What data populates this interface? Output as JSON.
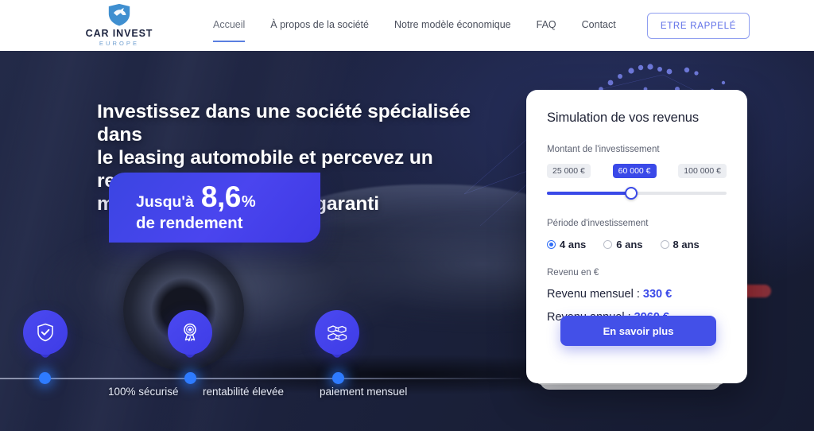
{
  "header": {
    "logo": {
      "name": "CAR INVEST",
      "sub": "EUROPE",
      "mark": "shield-car-icon"
    },
    "nav": [
      {
        "label": "Accueil",
        "active": true
      },
      {
        "label": "À propos de la société",
        "active": false
      },
      {
        "label": "Notre modèle économique",
        "active": false
      },
      {
        "label": "FAQ",
        "active": false
      },
      {
        "label": "Contact",
        "active": false
      }
    ],
    "cta": "ETRE RAPPELÉ"
  },
  "hero": {
    "title_line1": "Investissez dans une société spécialisée dans",
    "title_line2": "le leasing automobile et percevez un revenu",
    "title_line3": "mensuel satisfaisant et garanti",
    "badge": {
      "prefix": "Jusqu'à",
      "number": "8,6",
      "percent": "%",
      "line2": "de rendement"
    },
    "features": [
      {
        "label": "100% sécurisé",
        "icon": "shield-check-icon"
      },
      {
        "label": "rentabilité élevée",
        "icon": "award-ribbon-icon"
      },
      {
        "label": "paiement mensuel",
        "icon": "hand-money-icon"
      }
    ]
  },
  "simulator": {
    "title": "Simulation de vos revenus",
    "amount_label": "Montant de l'investissement",
    "amount_min": "25 000 €",
    "amount_current": "60 000 €",
    "amount_max": "100 000 €",
    "slider_percent": 47,
    "period_label": "Période d'investissement",
    "period_options": [
      {
        "label": "4 ans",
        "selected": true
      },
      {
        "label": "6 ans",
        "selected": false
      },
      {
        "label": "8 ans",
        "selected": false
      }
    ],
    "revenue_label": "Revenu en €",
    "monthly_prefix": "Revenu mensuel : ",
    "monthly_value": "330 €",
    "annual_prefix": "Revenu annuel : ",
    "annual_value": "3960 €",
    "cta": "En savoir plus"
  },
  "colors": {
    "accent_blue": "#3a49e8",
    "badge_blue": "#4a45ef",
    "header_cta_border": "#8f9ef0",
    "nav_active_underline": "#5a7fe0",
    "dark_navy": "#1d2340",
    "dot_blue": "#2e7bff"
  }
}
